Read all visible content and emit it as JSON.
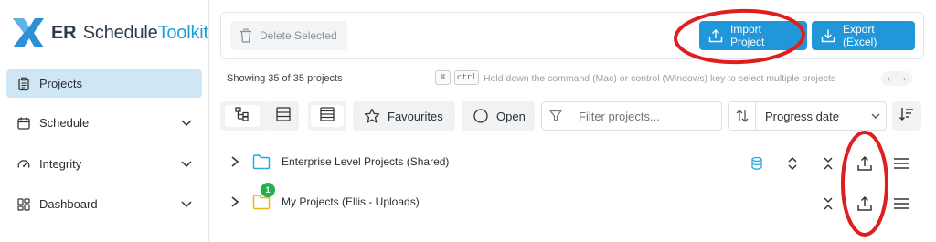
{
  "brand": {
    "prefix": "ER",
    "name_main": "Schedule",
    "name_accent": "Toolkit"
  },
  "sidebar": {
    "items": [
      {
        "label": "Projects",
        "icon": "clipboard-icon",
        "active": true
      },
      {
        "label": "Schedule",
        "icon": "calendar-icon",
        "active": false
      },
      {
        "label": "Integrity",
        "icon": "gauge-icon",
        "active": false
      },
      {
        "label": "Dashboard",
        "icon": "dashboard-icon",
        "active": false
      }
    ]
  },
  "toolbar": {
    "delete_label": "Delete Selected",
    "import_label": "Import Project",
    "export_label": "Export (Excel)"
  },
  "status": {
    "count_text": "Showing 35 of 35 projects",
    "kbd_cmd": "⌘",
    "kbd_ctrl": "ctrl",
    "hint_text": "Hold down the command (Mac) or control (Windows) key to select multiple projects"
  },
  "filters": {
    "favourites_label": "Favourites",
    "open_label": "Open",
    "search_placeholder": "Filter projects...",
    "sort_value": "Progress date"
  },
  "folders": [
    {
      "name": "Enterprise Level Projects (Shared)",
      "color": "#29a9e0",
      "badge": ""
    },
    {
      "name": "My Projects (Ellis - Uploads)",
      "color": "#f1b512",
      "badge": "1"
    }
  ],
  "colors": {
    "accent": "#2196d9",
    "active_bg": "#cfe6f7",
    "annotation": "#e01e1e"
  }
}
